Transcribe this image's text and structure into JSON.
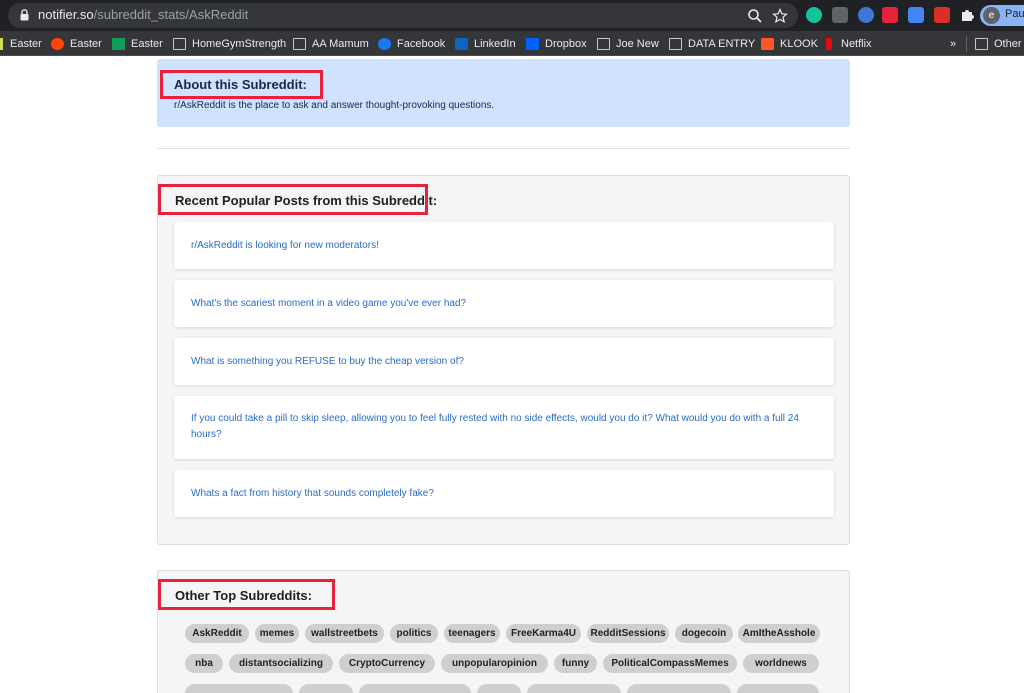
{
  "browser": {
    "url_host": "notifier.so",
    "url_path": "/subreddit_stats/AskReddit",
    "profile_label": "Pau"
  },
  "bookmarks": [
    {
      "label": "Easter",
      "icon": "vertical-bar-icon"
    },
    {
      "label": "Easter",
      "icon": "reddit-icon"
    },
    {
      "label": "Easter",
      "icon": "green-sheet-icon"
    },
    {
      "label": "HomeGymStrength",
      "icon": "folder-icon"
    },
    {
      "label": "AA Mamum",
      "icon": "folder-icon"
    },
    {
      "label": "Facebook",
      "icon": "facebook-icon"
    },
    {
      "label": "LinkedIn",
      "icon": "linkedin-icon"
    },
    {
      "label": "Dropbox",
      "icon": "dropbox-icon"
    },
    {
      "label": "Joe New",
      "icon": "folder-icon"
    },
    {
      "label": "DATA ENTRY",
      "icon": "folder-icon"
    },
    {
      "label": "KLOOK",
      "icon": "klook-icon"
    },
    {
      "label": "Netflix",
      "icon": "netflix-icon"
    }
  ],
  "bookmarks_overflow": "»",
  "other_bookmarks": "Other",
  "about": {
    "title": "About this Subreddit:",
    "description": "r/AskReddit is the place to ask and answer thought-provoking questions."
  },
  "recent_posts": {
    "title": "Recent Popular Posts from this Subreddit:",
    "posts": [
      "r/AskReddit is looking for new moderators!",
      "What's the scariest moment in a video game you've ever had?",
      "What is something you REFUSE to buy the cheap version of?",
      "If you could take a pill to skip sleep, allowing you to feel fully rested with no side effects, would you do it? What would you do with a full 24 hours?",
      "Whats a fact from history that sounds completely fake?"
    ]
  },
  "other_subreddits": {
    "title": "Other Top Subreddits:",
    "tags": [
      "AskReddit",
      "memes",
      "wallstreetbets",
      "politics",
      "teenagers",
      "FreeKarma4U",
      "RedditSessions",
      "dogecoin",
      "AmItheAsshole",
      "nba",
      "distantsocializing",
      "CryptoCurrency",
      "unpopularopinion",
      "funny",
      "PoliticalCompassMemes",
      "worldnews"
    ]
  },
  "colors": {
    "highlight_box": "#e8213c",
    "about_background": "#cfe2ff",
    "link": "#2a6cc7",
    "tag_background": "#cfcfcf"
  }
}
